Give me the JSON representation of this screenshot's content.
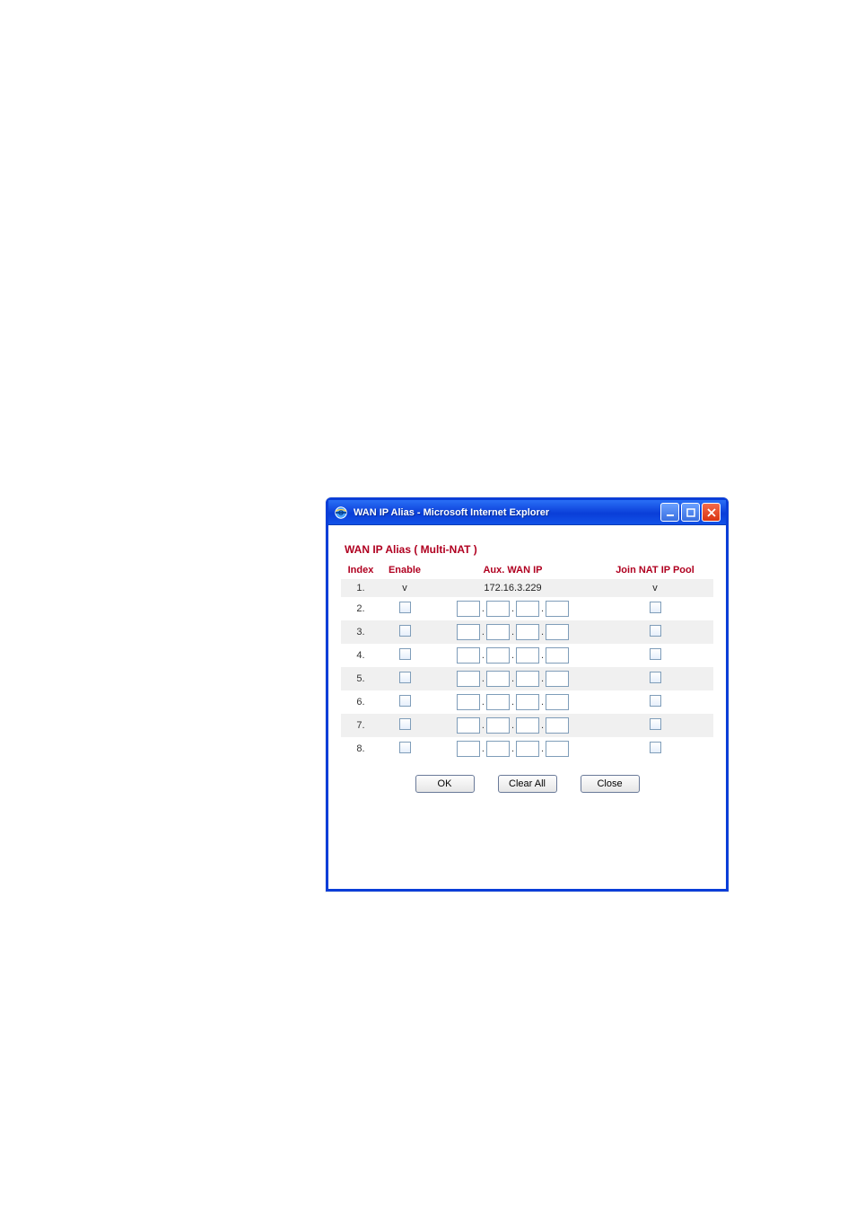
{
  "window": {
    "title": "WAN IP Alias - Microsoft Internet Explorer"
  },
  "heading": "WAN IP Alias ( Multi-NAT )",
  "columns": {
    "index": "Index",
    "enable": "Enable",
    "aux": "Aux. WAN IP",
    "pool": "Join NAT IP Pool"
  },
  "rows": [
    {
      "index": "1.",
      "static": true,
      "enable_display": "v",
      "ip_display": "172.16.3.229",
      "pool_display": "v"
    },
    {
      "index": "2.",
      "static": false
    },
    {
      "index": "3.",
      "static": false
    },
    {
      "index": "4.",
      "static": false
    },
    {
      "index": "5.",
      "static": false
    },
    {
      "index": "6.",
      "static": false
    },
    {
      "index": "7.",
      "static": false
    },
    {
      "index": "8.",
      "static": false
    }
  ],
  "buttons": {
    "ok": "OK",
    "clear": "Clear All",
    "close": "Close"
  },
  "icons": {
    "ie": "ie-icon",
    "min": "minimize-icon",
    "max": "maximize-icon",
    "close": "close-icon"
  }
}
